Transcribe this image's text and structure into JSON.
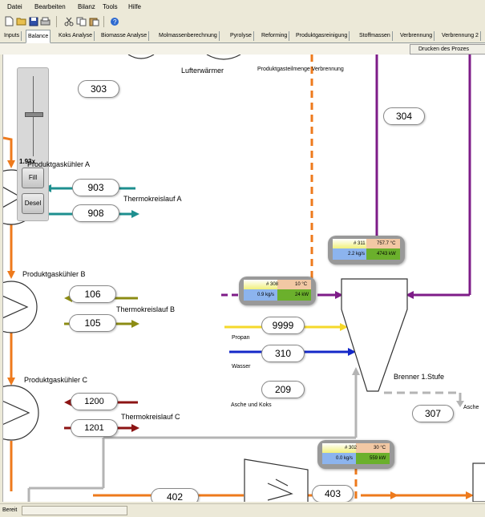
{
  "menu": {
    "items": [
      "Datei",
      "Bearbeiten",
      "Bilanz",
      "Tools",
      "Hilfe"
    ]
  },
  "toolbar": {
    "icons": [
      "new-file-icon",
      "open-folder-icon",
      "save-icon",
      "print-icon",
      "cut-icon",
      "copy-icon",
      "paste-icon",
      "help-icon"
    ]
  },
  "tabs": {
    "items": [
      "Inputs",
      "Balance",
      "Koks Analyse",
      "Biomasse Analyse",
      "Molmassenberechnung",
      "Pyrolyse",
      "Reforming",
      "Produktgasreinigung",
      "Stoffmassen",
      "Verbrennung",
      "Verbrennung 2"
    ],
    "active_index": 1
  },
  "print_button": {
    "label": "Drucken des Prozes"
  },
  "zoom": {
    "value_label": "1.93x",
    "fill_label": "Fill",
    "desel_label": "Desel"
  },
  "labels": {
    "lufterwaermer": "Lufterwärmer",
    "produktgasteilmenge": "Produktgasteilmenge Verbrennung",
    "pk_a": "Produktgaskühler A",
    "pk_b": "Produktgaskühler B",
    "pk_c": "Produktgaskühler C",
    "tk_a": "Thermokreislauf A",
    "tk_b": "Thermokreislauf B",
    "tk_c": "Thermokreislauf C",
    "propan": "Propan",
    "wasser": "Wasser",
    "asche_koks": "Asche und Koks",
    "brenner": "Brenner 1.Stufe",
    "asche": "Asche"
  },
  "nodes": {
    "n303": "303",
    "n304": "304",
    "n903": "903",
    "n908": "908",
    "n106": "106",
    "n105": "105",
    "n9999": "9999",
    "n310": "310",
    "n209": "209",
    "n307": "307",
    "n1200": "1200",
    "n1201": "1201",
    "n402": "402",
    "n403": "403"
  },
  "panels": {
    "p311": {
      "id": "# 311",
      "temp": "757.7 °C",
      "flow": "2.2 kg/s",
      "power": "4743 kW"
    },
    "p308": {
      "id": "# 308",
      "temp": "10 °C",
      "flow": "0.9 kg/s",
      "power": "24 kW"
    },
    "p302": {
      "id": "# 302",
      "temp": "30 °C",
      "flow": "0.0 kg/s",
      "power": "559 kW"
    }
  },
  "colors": {
    "orange": "#ee7a1c",
    "teal": "#1e8f8f",
    "olive": "#8c8c14",
    "darkred": "#8c1414",
    "purple": "#7e1c88",
    "yellow": "#f5d82a",
    "blue": "#1428c8",
    "gray": "#b4b4b4",
    "dashed_orange": "#ee7a1c"
  },
  "status": {
    "text": "Bereit"
  }
}
